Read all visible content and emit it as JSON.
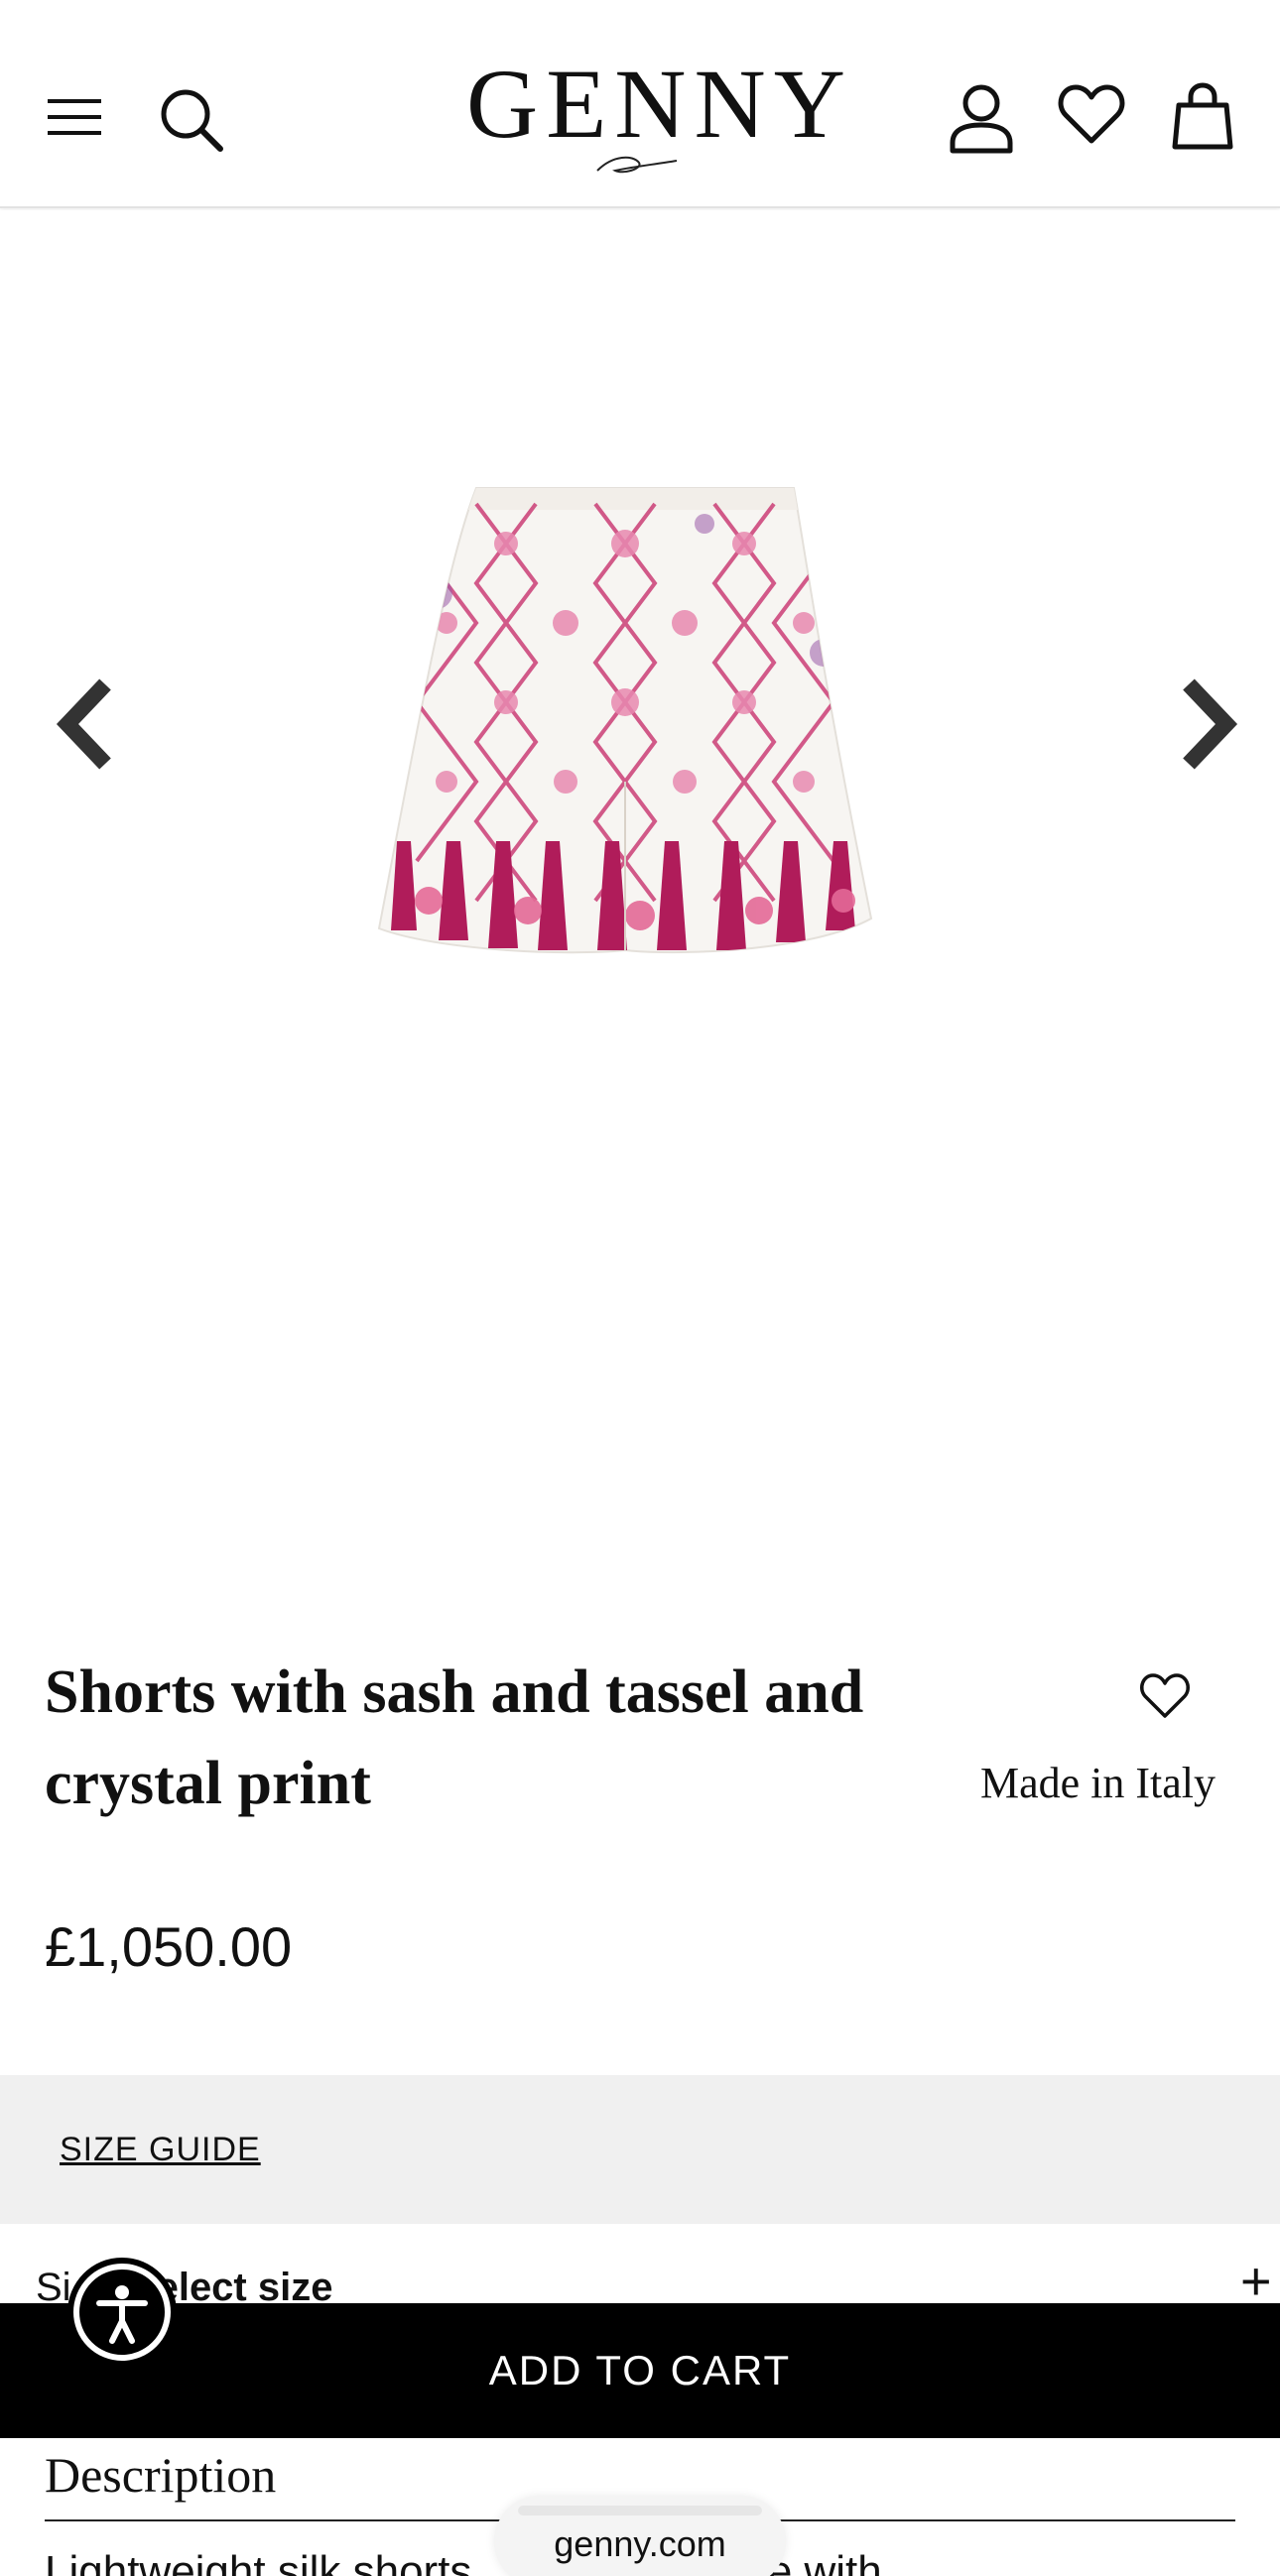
{
  "header": {
    "logo_text": "GENNY",
    "icons": [
      "menu-icon",
      "search-icon",
      "account-icon",
      "wishlist-icon",
      "shopping-bag-icon"
    ]
  },
  "gallery": {
    "icons": [
      "chevron-left-icon",
      "chevron-right-icon"
    ],
    "image_subject": "white shorts with pink floral trellis and tassel print"
  },
  "product": {
    "title": "Shorts with sash and tassel and crystal print",
    "made_in": "Made in Italy",
    "price": "£1,050.00"
  },
  "size_guide": {
    "label": "SIZE GUIDE"
  },
  "size_select": {
    "prefix": "Si",
    "label": "elect size",
    "expand": "+"
  },
  "cart": {
    "label": "ADD TO CART"
  },
  "accessibility": {
    "icon": "accessibility-icon"
  },
  "description": {
    "title": "Description",
    "text": "Lightweight silk shorts ... the silhouette with"
  },
  "browser": {
    "url": "genny.com"
  },
  "colors": {
    "accent": "#000000",
    "guide_bg": "#f0f0f0",
    "print_pink": "#c8336e"
  }
}
